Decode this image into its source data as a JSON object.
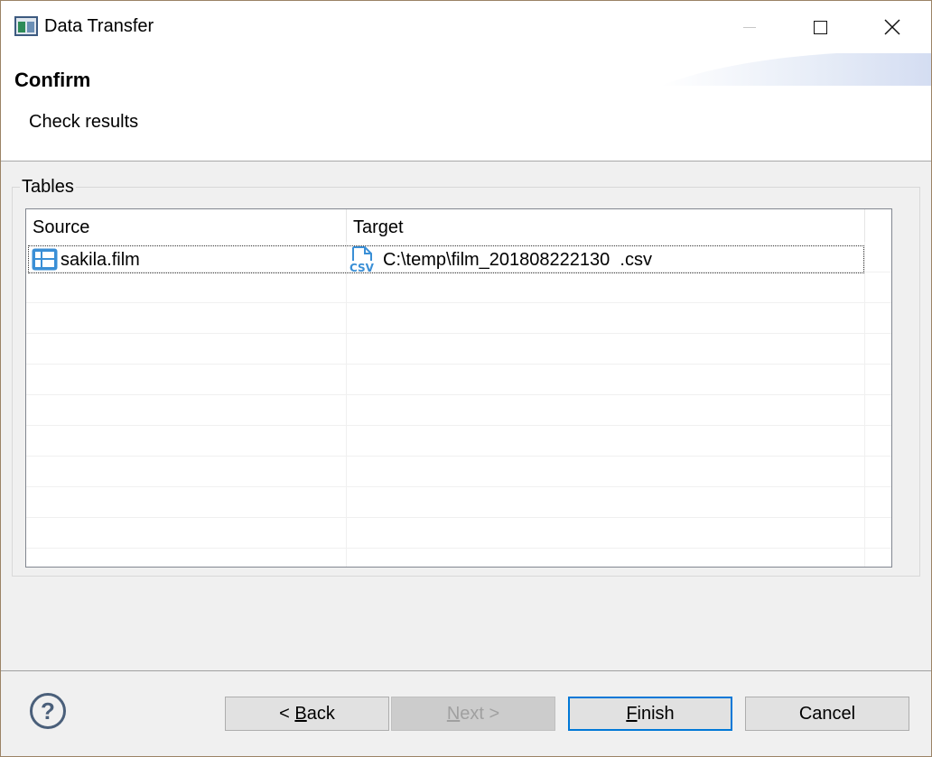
{
  "window": {
    "title": "Data Transfer",
    "icon": "app-icon"
  },
  "header": {
    "title": "Confirm",
    "description": "Check results"
  },
  "group": {
    "label": "Tables"
  },
  "table": {
    "columns": [
      "Source",
      "Target"
    ],
    "rows": [
      {
        "source": "sakila.film",
        "source_icon": "table-icon",
        "target": "C:\\temp\\film_201808222130  .csv",
        "target_icon": "csv-file-icon",
        "selected": true
      }
    ]
  },
  "footer": {
    "help_label": "?",
    "back_prefix": "< ",
    "back_mnemonic": "B",
    "back_rest": "ack",
    "next_mnemonic": "N",
    "next_rest": "ext >",
    "finish_mnemonic": "F",
    "finish_rest": "inish",
    "cancel_label": "Cancel"
  },
  "colors": {
    "accent": "#0078d7",
    "icon_blue": "#3a8fd6",
    "window_border": "#9b8366"
  }
}
